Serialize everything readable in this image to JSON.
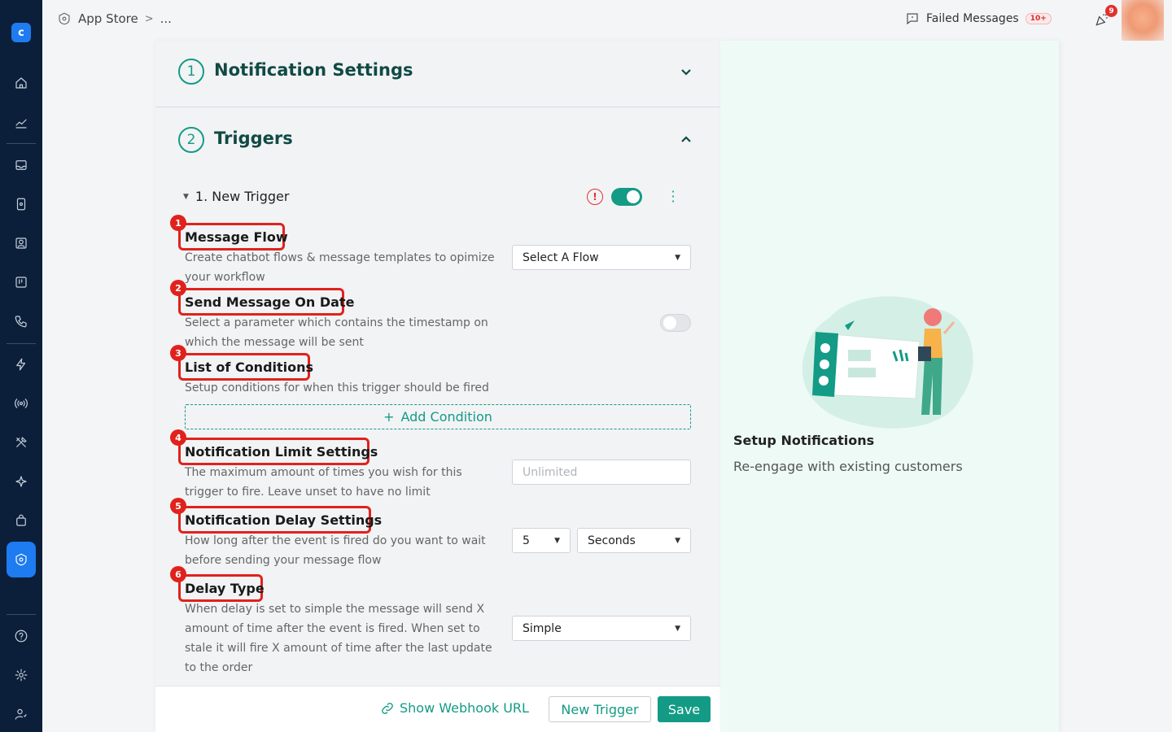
{
  "app": {
    "logo_letter": "c"
  },
  "breadcrumb": {
    "root": "App Store",
    "separator": ">",
    "current": "..."
  },
  "topbar": {
    "failed_label": "Failed Messages",
    "failed_badge": "10+",
    "notif_count": "9"
  },
  "sections": {
    "notification_settings": {
      "number": "1",
      "title": "Notification Settings",
      "expanded": false
    },
    "triggers": {
      "number": "2",
      "title": "Triggers",
      "expanded": true
    }
  },
  "trigger": {
    "name": "1. New Trigger",
    "warning_icon": "!",
    "enabled": true
  },
  "fields": {
    "message_flow": {
      "marker": "1",
      "title": "Message Flow",
      "desc": "Create chatbot flows & message templates to opimize your workflow",
      "select": "Select A Flow"
    },
    "send_on_date": {
      "marker": "2",
      "title": "Send Message On Date",
      "desc": "Select a parameter which contains the timestamp on which the message will be sent",
      "enabled": false
    },
    "conditions": {
      "marker": "3",
      "title": "List of Conditions",
      "desc": "Setup conditions for when this trigger should be fired",
      "add_label": "Add Condition"
    },
    "limit": {
      "marker": "4",
      "title": "Notification Limit Settings",
      "desc": "The maximum amount of times you wish for this trigger to fire. Leave unset to have no limit",
      "placeholder": "Unlimited"
    },
    "delay": {
      "marker": "5",
      "title": "Notification Delay Settings",
      "desc": "How long after the event is fired do you want to wait before sending your message flow",
      "amount": "5",
      "unit": "Seconds"
    },
    "delay_type": {
      "marker": "6",
      "title": "Delay Type",
      "desc": "When delay is set to simple the message will send X amount of time after the event is fired. When set to stale it will fire X amount of time after the last update to the order",
      "select": "Simple"
    }
  },
  "footer": {
    "webhook": "Show Webhook URL",
    "new_trigger": "New Trigger",
    "save": "Save"
  },
  "side_panel": {
    "title": "Setup Notifications",
    "subtitle": "Re-engage with existing customers"
  },
  "colors": {
    "accent": "#139b86",
    "highlight": "#e0221c",
    "sidebar": "#0b1f3a",
    "active": "#1e7bf0"
  }
}
